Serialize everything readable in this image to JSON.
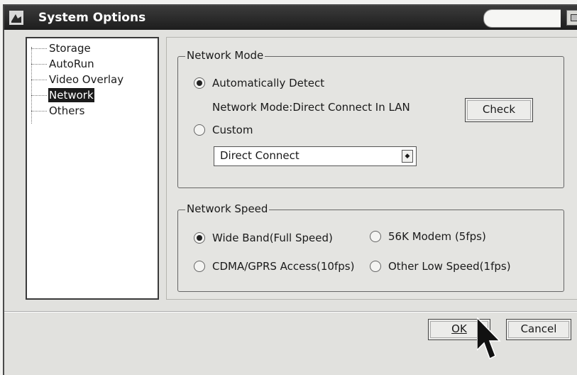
{
  "window": {
    "title": "System Options"
  },
  "tree": {
    "items": [
      {
        "label": "Storage",
        "selected": false
      },
      {
        "label": "AutoRun",
        "selected": false
      },
      {
        "label": "Video Overlay",
        "selected": false
      },
      {
        "label": "Network",
        "selected": true
      },
      {
        "label": "Others",
        "selected": false
      }
    ]
  },
  "network_mode": {
    "group_label": "Network Mode",
    "auto_detect_label": "Automatically Detect",
    "auto_detect_checked": true,
    "status_text": "Network Mode:Direct Connect In LAN",
    "check_button": "Check",
    "custom_label": "Custom",
    "custom_checked": false,
    "custom_select_value": "Direct Connect"
  },
  "network_speed": {
    "group_label": "Network Speed",
    "options": [
      {
        "label": "Wide Band(Full Speed)",
        "checked": true
      },
      {
        "label": "56K Modem (5fps)",
        "checked": false
      },
      {
        "label": "CDMA/GPRS Access(10fps)",
        "checked": false
      },
      {
        "label": "Other Low Speed(1fps)",
        "checked": false
      }
    ]
  },
  "footer": {
    "ok_label": "OK",
    "cancel_label": "Cancel"
  },
  "colors": {
    "titlebar": "#1d1d1d",
    "selection": "#1b1b1b",
    "window_bg": "#e1e1de"
  }
}
